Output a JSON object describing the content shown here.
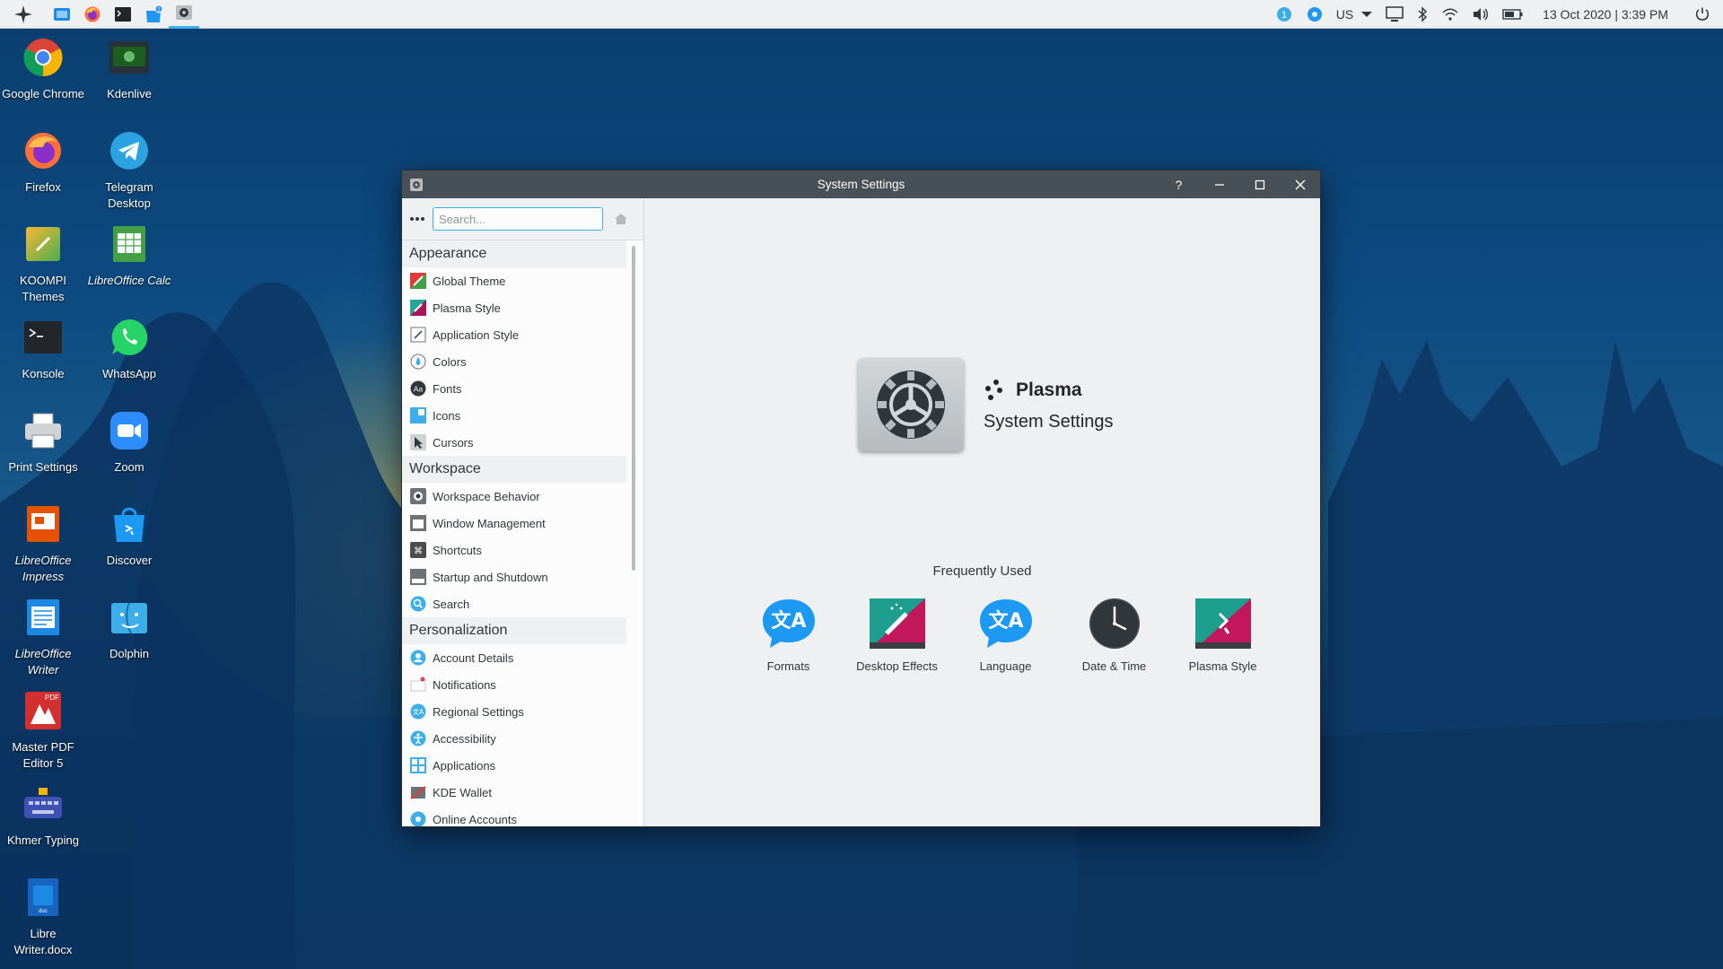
{
  "panel": {
    "tray": {
      "keyboard_layout": "US",
      "clock": "13 Oct 2020 | 3:39 PM",
      "notification_count": "1"
    }
  },
  "desktop": {
    "icons": [
      {
        "label": "Google Chrome"
      },
      {
        "label": "Kdenlive"
      },
      {
        "label": "Firefox"
      },
      {
        "label": "Telegram Desktop"
      },
      {
        "label": "KOOMPI Themes"
      },
      {
        "label": "LibreOffice Calc"
      },
      {
        "label": "Konsole"
      },
      {
        "label": "WhatsApp"
      },
      {
        "label": "Print Settings"
      },
      {
        "label": "Zoom"
      },
      {
        "label": "LibreOffice Impress"
      },
      {
        "label": "Discover"
      },
      {
        "label": "LibreOffice Writer"
      },
      {
        "label": "Dolphin"
      },
      {
        "label": "Master PDF Editor 5"
      },
      {
        "label": "Khmer Typing"
      },
      {
        "label": "Libre Writer.docx"
      }
    ]
  },
  "window": {
    "title": "System Settings",
    "help_label": "?",
    "search": {
      "placeholder": "Search...",
      "value": ""
    },
    "sidebar": {
      "categories": [
        {
          "title": "Appearance",
          "items": [
            "Global Theme",
            "Plasma Style",
            "Application Style",
            "Colors",
            "Fonts",
            "Icons",
            "Cursors"
          ]
        },
        {
          "title": "Workspace",
          "items": [
            "Workspace Behavior",
            "Window Management",
            "Shortcuts",
            "Startup and Shutdown",
            "Search"
          ]
        },
        {
          "title": "Personalization",
          "items": [
            "Account Details",
            "Notifications",
            "Regional Settings",
            "Accessibility",
            "Applications",
            "KDE Wallet",
            "Online Accounts"
          ]
        }
      ]
    },
    "main": {
      "brand": "Plasma",
      "subtitle": "System Settings",
      "frequently_used_title": "Frequently Used",
      "frequently_used": [
        "Formats",
        "Desktop Effects",
        "Language",
        "Date & Time",
        "Plasma Style"
      ]
    }
  },
  "colors": {
    "accent": "#3daee9",
    "titlebar": "#475057",
    "window_bg": "#eff0f1",
    "sidebar_bg": "#fcfcfc"
  }
}
